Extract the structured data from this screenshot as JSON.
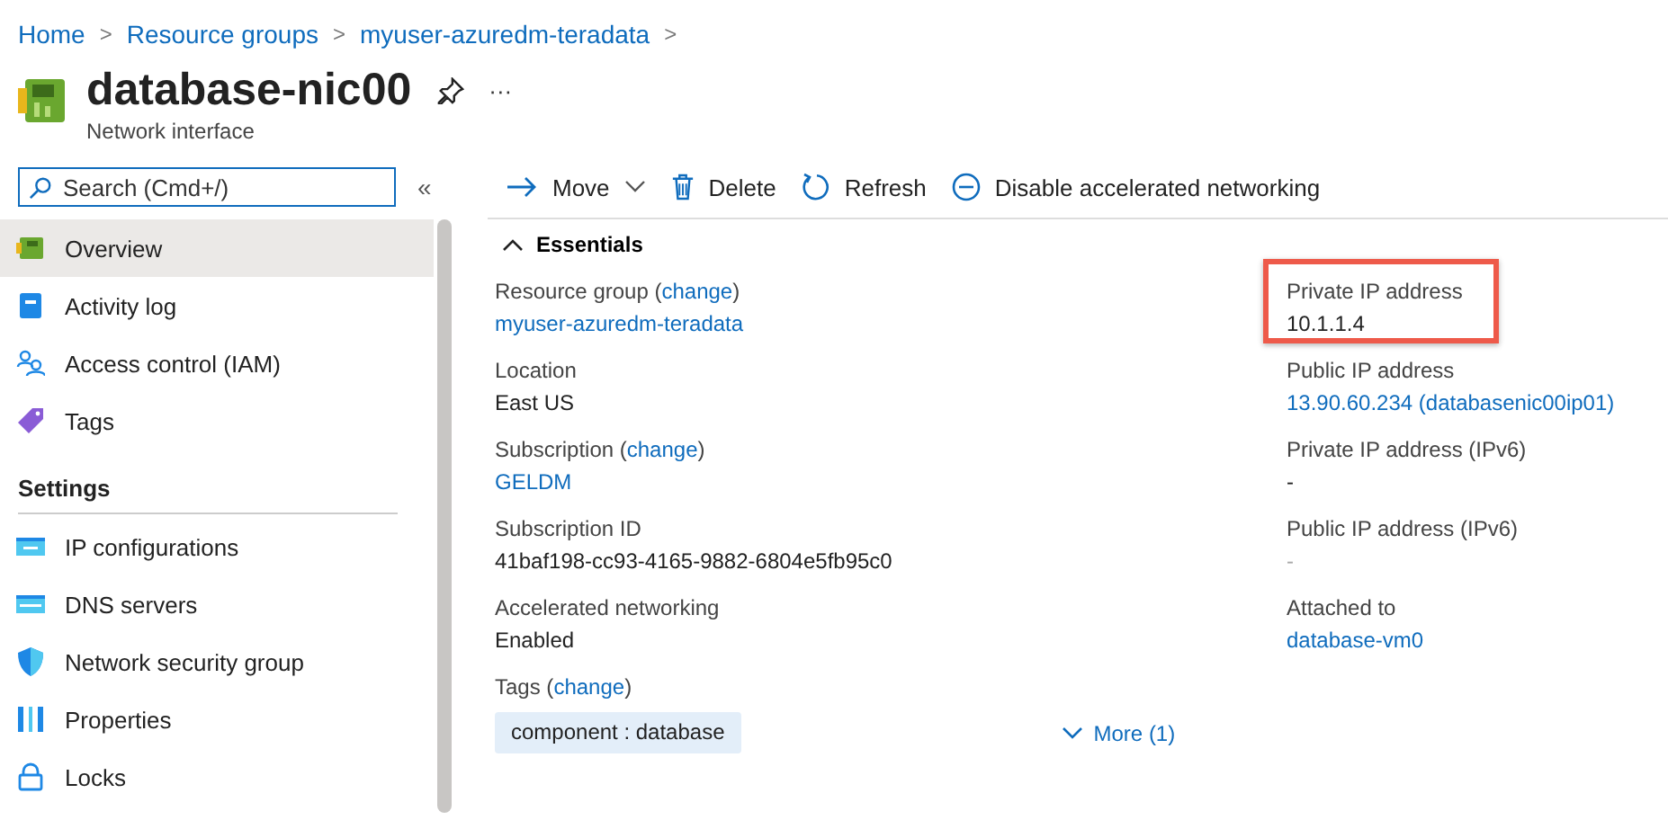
{
  "breadcrumb": [
    {
      "label": "Home"
    },
    {
      "label": "Resource groups"
    },
    {
      "label": "myuser-azuredm-teradata"
    }
  ],
  "breadcrumb_separator": ">",
  "header": {
    "title": "database-nic00",
    "subtitle": "Network interface",
    "more": "···"
  },
  "search": {
    "placeholder": "Search (Cmd+/)"
  },
  "collapse": "«",
  "sidebar": {
    "items": [
      {
        "label": "Overview",
        "selected": true
      },
      {
        "label": "Activity log",
        "selected": false
      },
      {
        "label": "Access control (IAM)",
        "selected": false
      },
      {
        "label": "Tags",
        "selected": false
      }
    ],
    "sections": [
      {
        "title": "Settings",
        "items": [
          {
            "label": "IP configurations",
            "selected": false
          },
          {
            "label": "DNS servers",
            "selected": false
          },
          {
            "label": "Network security group",
            "selected": false
          },
          {
            "label": "Properties",
            "selected": false
          },
          {
            "label": "Locks",
            "selected": false
          }
        ]
      }
    ]
  },
  "toolbar": [
    {
      "label": "Move",
      "dropdown": true
    },
    {
      "label": "Delete",
      "dropdown": false
    },
    {
      "label": "Refresh",
      "dropdown": false
    },
    {
      "label": "Disable accelerated networking",
      "dropdown": false
    }
  ],
  "essentials": {
    "title": "Essentials",
    "expanded": true,
    "left": [
      {
        "label": "Resource group (",
        "label_link": "change",
        "label_end": ")",
        "value": "myuser-azuredm-teradata",
        "kind": "link"
      },
      {
        "label": "Location",
        "value": "East US",
        "kind": "text"
      },
      {
        "label": "Subscription (",
        "label_link": "change",
        "label_end": ")",
        "value": "GELDM",
        "kind": "link"
      },
      {
        "label": "Subscription ID",
        "value": "41baf198-cc93-4165-9882-6804e5fb95c0",
        "kind": "text"
      },
      {
        "label": "Accelerated networking",
        "value": "Enabled",
        "kind": "text"
      }
    ],
    "right": [
      {
        "label": "Private IP address",
        "value": "10.1.1.4",
        "kind": "text",
        "highlighted": true
      },
      {
        "label": "Public IP address",
        "value": "13.90.60.234 (databasenic00ip01)",
        "kind": "link",
        "highlighted": false
      },
      {
        "label": "Private IP address (IPv6)",
        "value": "-",
        "kind": "text",
        "highlighted": false
      },
      {
        "label": "Public IP address (IPv6)",
        "value": "-",
        "kind": "muted",
        "highlighted": false
      },
      {
        "label": "Attached to",
        "value": "database-vm0",
        "kind": "link",
        "highlighted": false
      }
    ],
    "tags": {
      "label": "Tags (",
      "label_link": "change",
      "label_end": ")",
      "items": [
        "component : database"
      ],
      "more": "More (1)"
    }
  }
}
